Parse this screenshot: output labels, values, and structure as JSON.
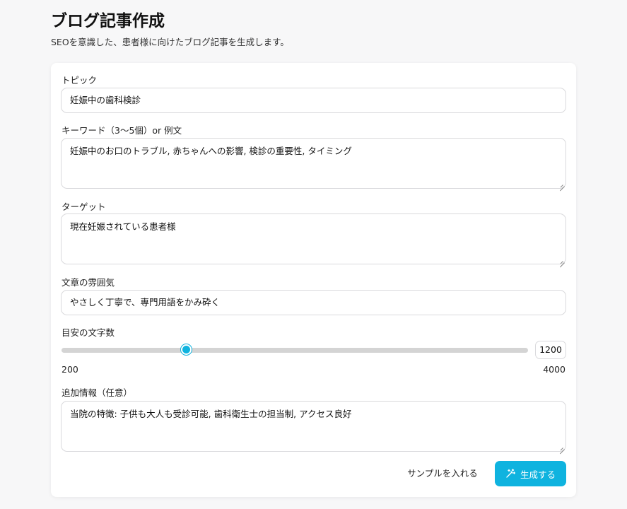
{
  "header": {
    "title": "ブログ記事作成",
    "subtitle": "SEOを意識した、患者様に向けたブログ記事を生成します。"
  },
  "form": {
    "topic": {
      "label": "トピック",
      "value": "妊娠中の歯科検診"
    },
    "keywords": {
      "label": "キーワード（3〜5個）or 例文",
      "value": "妊娠中のお口のトラブル, 赤ちゃんへの影響, 検診の重要性, タイミング"
    },
    "target": {
      "label": "ターゲット",
      "value": "現在妊娠されている患者様"
    },
    "tone": {
      "label": "文章の雰囲気",
      "value": "やさしく丁寧で、専門用語をかみ砕く"
    },
    "length": {
      "label": "目安の文字数",
      "min": "200",
      "max": "4000",
      "value": "1200"
    },
    "extra": {
      "label": "追加情報（任意）",
      "value": "当院の特徴: 子供も大人も受診可能, 歯科衛生士の担当制, アクセス良好"
    }
  },
  "actions": {
    "sample_label": "サンプルを入れる",
    "generate_label": "生成する",
    "generate_icon": "magic-wand-icon"
  },
  "colors": {
    "accent": "#0fb3df",
    "border": "#d9d9dc",
    "slider_track": "#d4d4d4"
  }
}
